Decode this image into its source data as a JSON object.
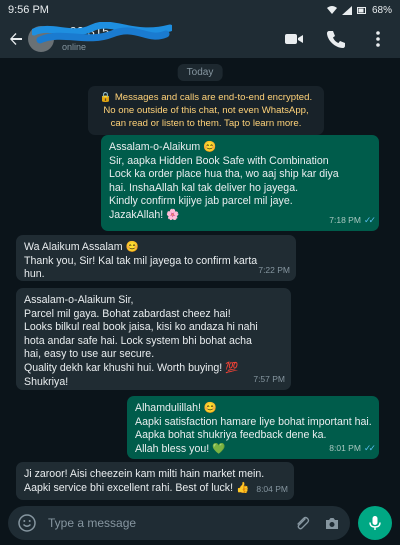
{
  "status_bar": {
    "time": "9:56 PM",
    "battery": "68%"
  },
  "header": {
    "contact_name": "+92 315",
    "subtitle": "online"
  },
  "chat": {
    "date_label": "Today",
    "encryption_notice": "Messages and calls are end-to-end encrypted. No one outside of this chat, not even WhatsApp, can read or listen to them. Tap to learn more.",
    "messages": [
      {
        "direction": "outgoing",
        "lines": [
          "Assalam-o-Alaikum 😊",
          "Sir, aapka Hidden Book Safe with Combination",
          "Lock ka order place hua tha, wo aaj ship kar diya",
          "hai. InshaAllah kal tak deliver ho jayega.",
          "Kindly confirm kijiye jab parcel mil jaye.",
          "JazakAllah! 🌸"
        ],
        "time": "7:18 PM",
        "status": "read"
      },
      {
        "direction": "incoming",
        "lines": [
          "Wa Alaikum Assalam 😊",
          "Thank you, Sir! Kal tak mil jayega to confirm karta",
          "hun."
        ],
        "time": "7:22 PM"
      },
      {
        "direction": "incoming",
        "lines": [
          "Assalam-o-Alaikum Sir,",
          "Parcel mil gaya. Bohat zabardast cheez hai!",
          "Looks bilkul real book jaisa, kisi ko andaza hi nahi",
          "hota andar safe hai. Lock system bhi bohat acha",
          "hai, easy to use aur secure.",
          "Quality dekh kar khushi hui. Worth buying! 💯",
          "Shukriya!"
        ],
        "time": "7:57 PM"
      },
      {
        "direction": "outgoing",
        "lines": [
          "Alhamdulillah! 😊",
          "Aapki satisfaction hamare liye bohat important hai.",
          "Aapka bohat shukriya feedback dene ka.",
          "Allah bless you! 💚"
        ],
        "time": "8:01 PM",
        "status": "read"
      },
      {
        "direction": "incoming",
        "lines": [
          "Ji zaroor! Aisi cheezein kam milti hain market mein.",
          "Aapki service bhi excellent rahi. Best of luck! 👍"
        ],
        "time": "8:04 PM"
      }
    ]
  },
  "input": {
    "placeholder": "Type a message"
  },
  "icons": {
    "back": "arrow-left-icon",
    "video": "video-call-icon",
    "call": "phone-icon",
    "menu": "more-vert-icon",
    "emoji": "emoji-icon",
    "attach": "paperclip-icon",
    "camera": "camera-icon",
    "mic": "mic-icon",
    "lock": "lock-icon"
  },
  "colors": {
    "outgoing_bubble": "#005c4b",
    "incoming_bubble": "#202c33",
    "accent": "#00a884",
    "read_ticks": "#53bdeb",
    "notice_text": "#ffd279",
    "background": "#0b141a"
  }
}
